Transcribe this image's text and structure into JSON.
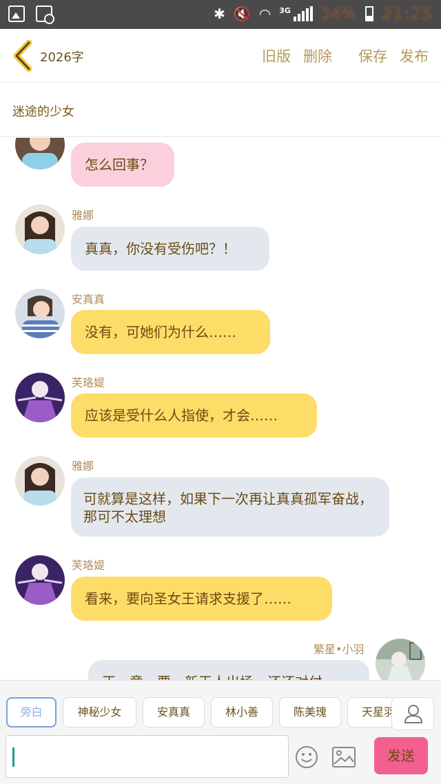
{
  "status_bar": {
    "network": "3G",
    "battery_percent": "34%",
    "time": "21:25"
  },
  "header": {
    "word_count": "2026字",
    "actions": [
      "旧版",
      "删除",
      "保存",
      "发布"
    ]
  },
  "story": {
    "title": "迷途的少女"
  },
  "messages": [
    {
      "speaker": "",
      "text": "怎么回事？",
      "color": "#fbd0dc"
    },
    {
      "speaker": "雅娜",
      "text": "真真，你没有受伤吧？！",
      "color": "#e3e8ef"
    },
    {
      "speaker": "安真真",
      "text": "没有，可她们为什么……",
      "color": "#fddc68"
    },
    {
      "speaker": "芙珞媞",
      "text": "应该是受什么人指使，才会……",
      "color": "#fddc68"
    },
    {
      "speaker": "雅娜",
      "text": "可就算是这样，如果下一次再让真真孤军奋战，那可不太理想",
      "color": "#e3e8ef"
    },
    {
      "speaker": "芙珞媞",
      "text": "看来，要向圣女王请求支援了……",
      "color": "#fddc68"
    },
    {
      "speaker": "繁星•小羽",
      "text": "正…意…要…新天人出场…还还对付",
      "color": "#e3e8ef"
    }
  ],
  "composer": {
    "roles": [
      "旁白",
      "神秘少女",
      "安真真",
      "林小善",
      "陈美瑰",
      "天星羽"
    ],
    "active_role": "旁白",
    "send_label": "发送",
    "icons": [
      "role-select-icon",
      "emoji-icon",
      "image-icon"
    ],
    "accent_color": "#f35f8e"
  }
}
